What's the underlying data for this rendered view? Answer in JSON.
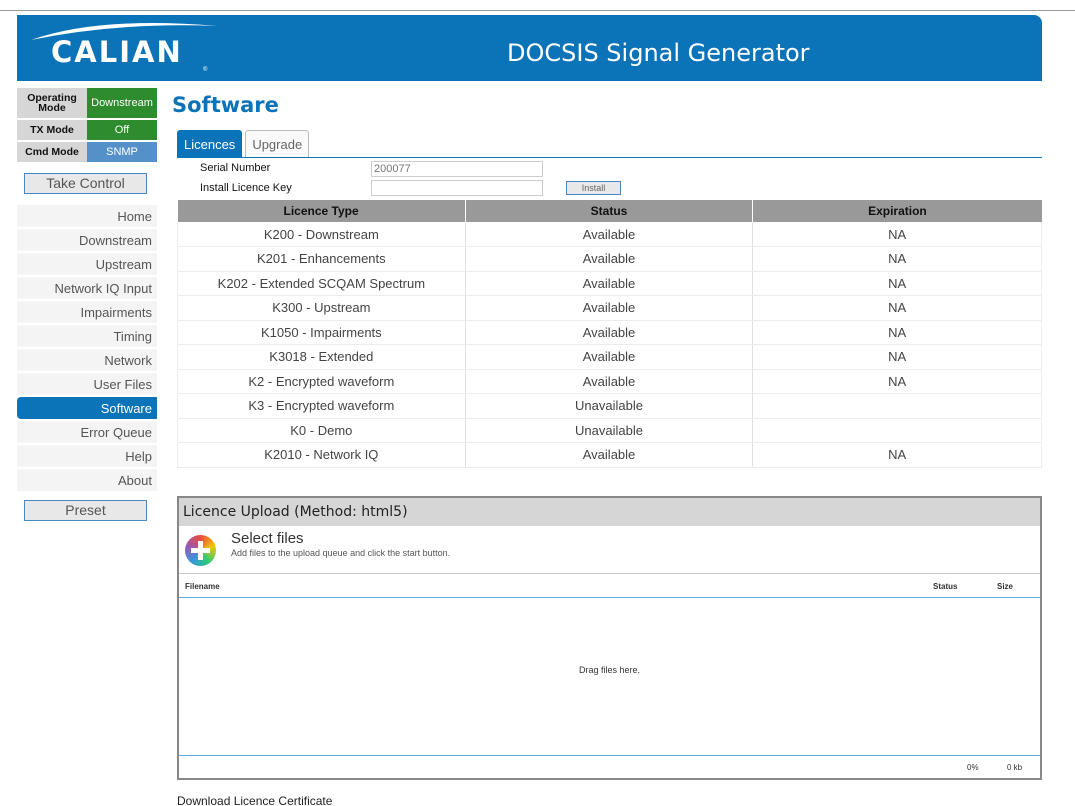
{
  "header": {
    "logo_text": "CALIAN",
    "logo_mark": "®",
    "title": "DOCSIS Signal Generator"
  },
  "status": [
    {
      "label": "Operating Mode",
      "value": "Downstream"
    },
    {
      "label": "TX Mode",
      "value": "Off"
    },
    {
      "label": "Cmd Mode",
      "value": "SNMP"
    }
  ],
  "buttons": {
    "take_control": "Take Control",
    "preset": "Preset"
  },
  "nav": [
    "Home",
    "Downstream",
    "Upstream",
    "Network IQ Input",
    "Impairments",
    "Timing",
    "Network",
    "User Files",
    "Software",
    "Error Queue",
    "Help",
    "About"
  ],
  "page": {
    "title": "Software",
    "tabs": [
      "Licences",
      "Upgrade"
    ]
  },
  "form": {
    "serial_label": "Serial Number",
    "serial_value": "200077",
    "key_label": "Install Licence Key",
    "key_value": "",
    "install_label": "Install"
  },
  "licence_table": {
    "headers": [
      "Licence Type",
      "Status",
      "Expiration"
    ],
    "rows": [
      [
        "K200 - Downstream",
        "Available",
        "NA"
      ],
      [
        "K201 - Enhancements",
        "Available",
        "NA"
      ],
      [
        "K202 - Extended SCQAM Spectrum",
        "Available",
        "NA"
      ],
      [
        "K300 - Upstream",
        "Available",
        "NA"
      ],
      [
        "K1050 - Impairments",
        "Available",
        "NA"
      ],
      [
        "K3018 - Extended",
        "Available",
        "NA"
      ],
      [
        "K2 - Encrypted waveform",
        "Available",
        "NA"
      ],
      [
        "K3 - Encrypted waveform",
        "Unavailable",
        ""
      ],
      [
        "K0 - Demo",
        "Unavailable",
        ""
      ],
      [
        "K2010 - Network IQ",
        "Available",
        "NA"
      ]
    ]
  },
  "upload": {
    "title": "Licence Upload (Method: html5)",
    "select_title": "Select files",
    "select_sub": "Add files to the upload queue and click the start button.",
    "col_filename": "Filename",
    "col_status": "Status",
    "col_size": "Size",
    "drop_text": "Drag files here.",
    "total_percent": "0%",
    "total_size": "0 kb"
  },
  "download_label": "Download Licence Certificate",
  "colors": {
    "brand_blue": "#0b73b8",
    "status_green": "#2e8b2e",
    "status_blue": "#5591c8"
  }
}
